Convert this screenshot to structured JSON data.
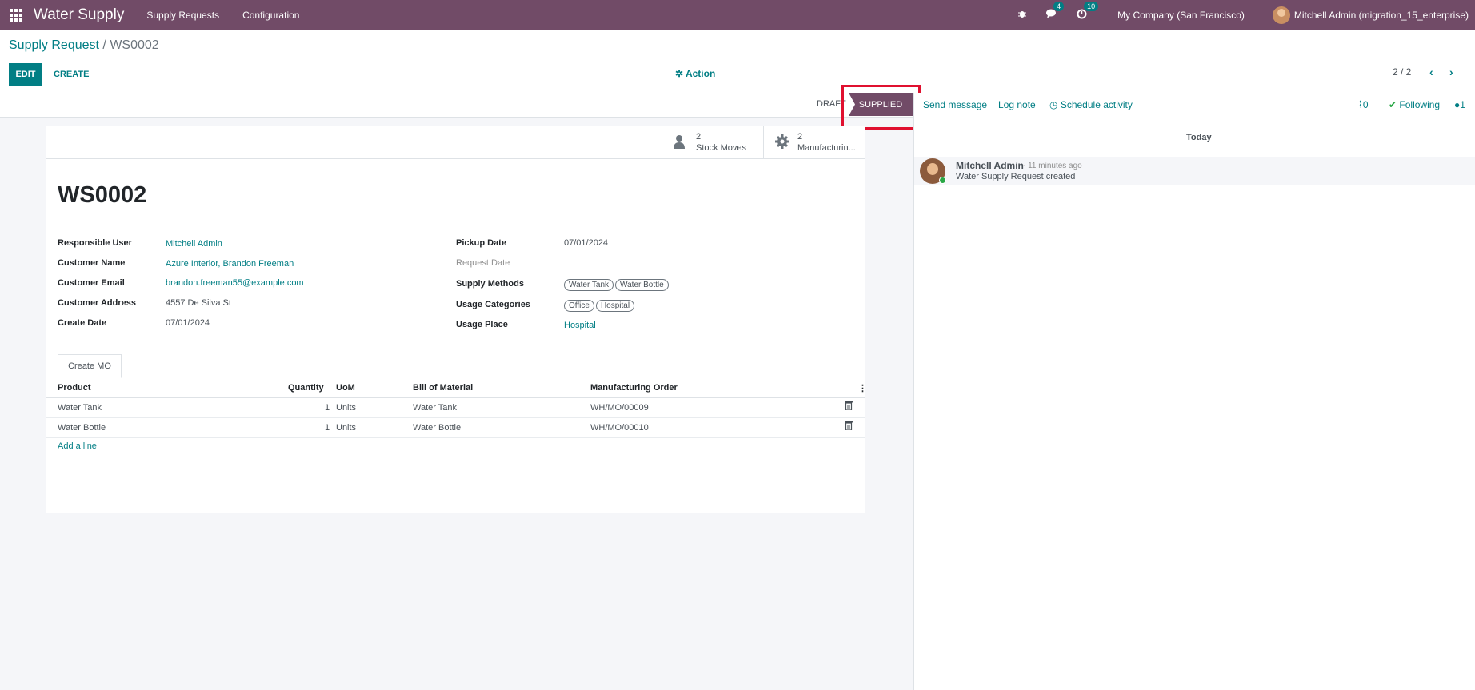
{
  "navbar": {
    "app_title": "Water Supply",
    "menus": [
      "Supply Requests",
      "Configuration"
    ],
    "messages_count": "4",
    "activities_count": "10",
    "company": "My Company (San Francisco)",
    "user": "Mitchell Admin (migration_15_enterprise)"
  },
  "control": {
    "breadcrumb_parent": "Supply Request",
    "breadcrumb_sep": " / ",
    "breadcrumb_current": "WS0002",
    "edit_label": "EDIT",
    "create_label": "CREATE",
    "action_label": "Action",
    "pager": "2 / 2"
  },
  "status": {
    "stages": [
      "DRAFT",
      "SUPPLIED"
    ],
    "current": "SUPPLIED"
  },
  "chatter": {
    "send_message": "Send message",
    "log_note": "Log note",
    "schedule_activity": "Schedule activity",
    "attachments": "0",
    "following": "Following",
    "followers": "1",
    "date_separator": "Today",
    "message": {
      "author": "Mitchell Admin",
      "time": "- 11 minutes ago",
      "body": "Water Supply Request created"
    }
  },
  "form": {
    "smart_buttons": [
      {
        "value": "2",
        "label": "Stock Moves"
      },
      {
        "value": "2",
        "label": "Manufacturin..."
      }
    ],
    "name": "WS0002",
    "left_fields": [
      {
        "label": "Responsible User",
        "value": "Mitchell Admin"
      },
      {
        "label": "Customer Name",
        "value": "Azure Interior, Brandon Freeman"
      },
      {
        "label": "Customer Email",
        "value": "brandon.freeman55@example.com"
      },
      {
        "label": "Customer Address",
        "value": "4557 De Silva St"
      },
      {
        "label": "Create Date",
        "value": "07/01/2024"
      }
    ],
    "right_fields": {
      "pickup_date_label": "Pickup Date",
      "pickup_date": "07/01/2024",
      "request_date_label": "Request Date",
      "supply_methods_label": "Supply Methods",
      "supply_methods": [
        "Water Tank",
        "Water Bottle"
      ],
      "usage_categories_label": "Usage Categories",
      "usage_categories": [
        "Office",
        "Hospital"
      ],
      "usage_place_label": "Usage Place",
      "usage_place": "Hospital"
    },
    "tab": "Create MO",
    "table": {
      "headers": [
        "Product",
        "Quantity",
        "UoM",
        "Bill of Material",
        "Manufacturing Order"
      ],
      "rows": [
        {
          "product": "Water Tank",
          "quantity": "1",
          "uom": "Units",
          "bom": "Water Tank",
          "mo": "WH/MO/00009"
        },
        {
          "product": "Water Bottle",
          "quantity": "1",
          "uom": "Units",
          "bom": "Water Bottle",
          "mo": "WH/MO/00010"
        }
      ],
      "add_line": "Add a line"
    }
  }
}
